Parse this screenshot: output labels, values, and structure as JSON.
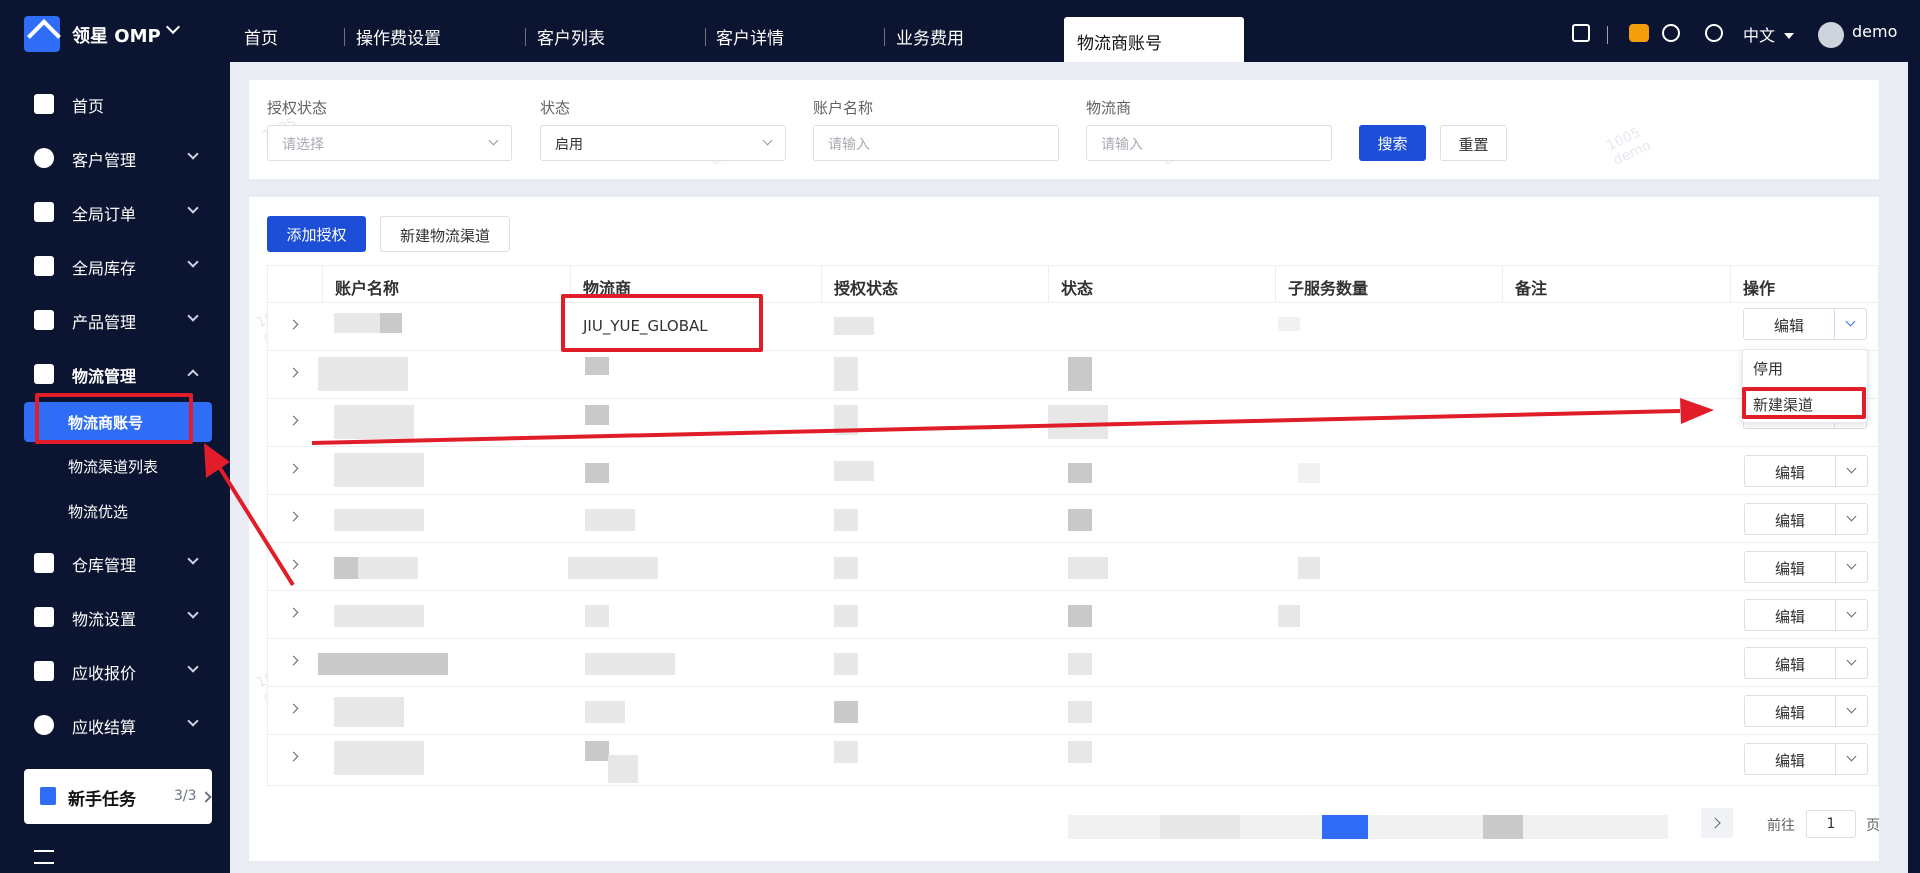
{
  "topbar": {
    "brand": "领星 OMP",
    "tabs": [
      {
        "label": "首页"
      },
      {
        "label": "操作费设置"
      },
      {
        "label": "客户列表"
      },
      {
        "label": "客户详情"
      },
      {
        "label": "业务费用"
      },
      {
        "label": "物流商账号",
        "active": true
      }
    ],
    "language": "中文",
    "user": "demo"
  },
  "sidebar": {
    "items": [
      {
        "label": "首页",
        "icon": "home-icon"
      },
      {
        "label": "客户管理",
        "icon": "users-icon"
      },
      {
        "label": "全局订单",
        "icon": "clipboard-icon"
      },
      {
        "label": "全局库存",
        "icon": "warehouse-icon"
      },
      {
        "label": "产品管理",
        "icon": "box-icon"
      },
      {
        "label": "物流管理",
        "icon": "truck-icon",
        "expanded": true,
        "children": [
          {
            "label": "物流商账号",
            "active": true
          },
          {
            "label": "物流渠道列表"
          },
          {
            "label": "物流优选"
          }
        ]
      },
      {
        "label": "仓库管理",
        "icon": "store-icon"
      },
      {
        "label": "物流设置",
        "icon": "cube-icon"
      },
      {
        "label": "应收报价",
        "icon": "document-icon"
      },
      {
        "label": "应收结算",
        "icon": "dollar-icon"
      }
    ],
    "task": {
      "label": "新手任务",
      "count": "3/3"
    }
  },
  "filters": {
    "auth_status": {
      "label": "授权状态",
      "placeholder": "请选择"
    },
    "status": {
      "label": "状态",
      "value": "启用"
    },
    "account_name": {
      "label": "账户名称",
      "placeholder": "请输入"
    },
    "provider": {
      "label": "物流商",
      "placeholder": "请输入"
    },
    "search_label": "搜索",
    "reset_label": "重置"
  },
  "toolbar": {
    "add_auth_label": "添加授权",
    "new_channel_label": "新建物流渠道"
  },
  "table": {
    "columns": [
      "账户名称",
      "物流商",
      "授权状态",
      "状态",
      "子服务数量",
      "备注",
      "操作"
    ],
    "first_row_provider": "JIU_YUE_GLOBAL",
    "edit_label": "编辑",
    "dropdown": [
      "停用",
      "新建渠道"
    ]
  },
  "pagination": {
    "goto_prefix": "前往",
    "page": "1",
    "suffix": "页"
  },
  "watermark": {
    "line1": "1005",
    "line2": "demo"
  },
  "colors": {
    "primary": "#1d4ed8",
    "sidebar": "#0b1430",
    "annotation": "#e11d2a"
  }
}
